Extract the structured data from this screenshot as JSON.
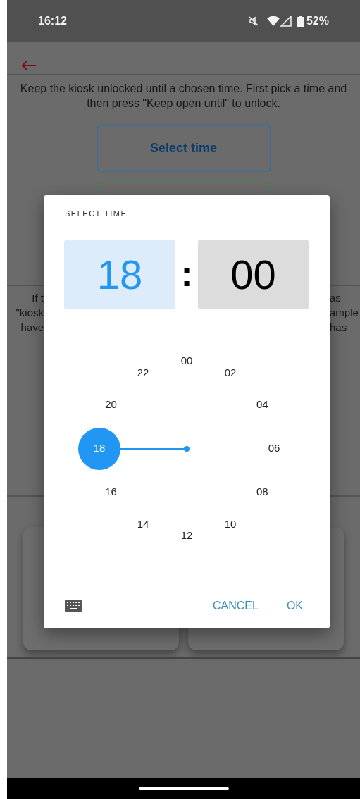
{
  "status_bar": {
    "time": "16:12",
    "battery": "52%"
  },
  "page": {
    "intro": "Keep the kiosk unlocked until a chosen time. First pick a time and then press \"Keep open until\" to unlock.",
    "select_button": "Select time",
    "left_fragments": [
      "If t",
      "\"kiosk",
      "have"
    ],
    "right_fragments": [
      "as",
      "ample",
      "has"
    ]
  },
  "dialog": {
    "title": "SELECT TIME",
    "hour": "18",
    "separator": ":",
    "minute": "00",
    "hour_selected": true,
    "numbers": [
      {
        "label": "00",
        "selected": false
      },
      {
        "label": "02",
        "selected": false
      },
      {
        "label": "04",
        "selected": false
      },
      {
        "label": "06",
        "selected": false
      },
      {
        "label": "08",
        "selected": false
      },
      {
        "label": "10",
        "selected": false
      },
      {
        "label": "12",
        "selected": false
      },
      {
        "label": "14",
        "selected": false
      },
      {
        "label": "16",
        "selected": false
      },
      {
        "label": "18",
        "selected": true
      },
      {
        "label": "20",
        "selected": false
      },
      {
        "label": "22",
        "selected": false
      }
    ],
    "buttons": [
      "CANCEL",
      "OK"
    ]
  }
}
